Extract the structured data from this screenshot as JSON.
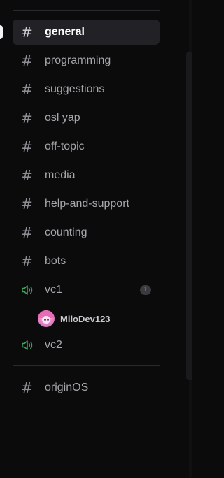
{
  "channels": [
    {
      "name": "general",
      "type": "text",
      "active": true
    },
    {
      "name": "programming",
      "type": "text"
    },
    {
      "name": "suggestions",
      "type": "text"
    },
    {
      "name": "osl yap",
      "type": "text"
    },
    {
      "name": "off-topic",
      "type": "text"
    },
    {
      "name": "media",
      "type": "text"
    },
    {
      "name": "help-and-support",
      "type": "text"
    },
    {
      "name": "counting",
      "type": "text"
    },
    {
      "name": "bots",
      "type": "text"
    },
    {
      "name": "vc1",
      "type": "voice",
      "badge": "1"
    },
    {
      "name": "vc2",
      "type": "voice"
    }
  ],
  "voice_users": [
    {
      "name": "MiloDev123"
    }
  ],
  "other_channels": [
    {
      "name": "originOS",
      "type": "text"
    }
  ],
  "icons": {
    "hash": "#",
    "speaker": "speaker-icon"
  },
  "colors": {
    "voice_icon": "#3ba55c",
    "active_bg": "#222226",
    "background": "#0b0b0c"
  }
}
